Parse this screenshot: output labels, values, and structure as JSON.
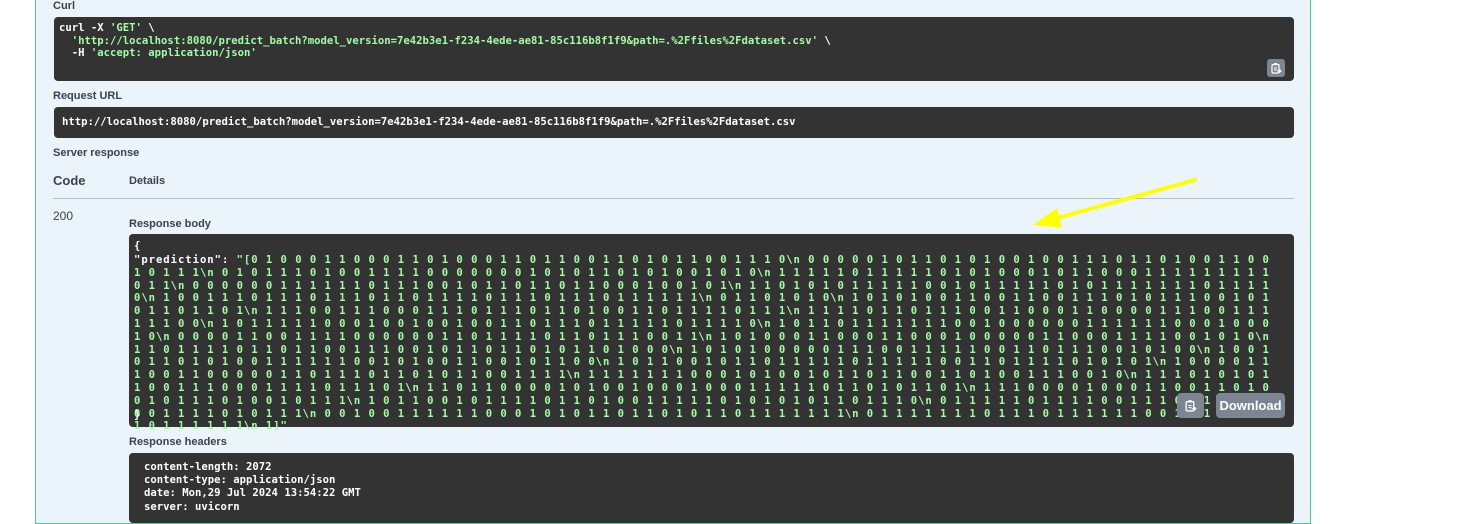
{
  "curl": {
    "label": "Curl",
    "line1_cmd": "curl -X ",
    "line1_method": "'GET'",
    "line1_end": " \\",
    "line2_url": "'http://localhost:8080/predict_batch?model_version=7e42b3e1-f234-4ede-ae81-85c116b8f1f9&path=.%2Ffiles%2Fdataset.csv'",
    "line2_end": " \\",
    "line3_flag": "-H ",
    "line3_header": "'accept: application/json'"
  },
  "request_url": {
    "label": "Request URL",
    "value": "http://localhost:8080/predict_batch?model_version=7e42b3e1-f234-4ede-ae81-85c116b8f1f9&path=.%2Ffiles%2Fdataset.csv"
  },
  "server_response": {
    "label": "Server response",
    "code_header": "Code",
    "details_header": "Details",
    "code": "200",
    "body_label": "Response body",
    "body_open": "{",
    "body_key": "\"prediction\"",
    "body_colon": ": ",
    "body_value": "\"[0 1 0 0 0 1 1 0 0 0 1 1 0 1 0 0 0 1 1 0 1 1 0 0 1 1 0 1 0 1 1 0 0 1 1 1 0\\n 0 0 0 0 0 1 0 1 1 0 1 0 1 0 0 1 0 0 1 1 1 0 1 1 0 1 0 0 1 1 0 0 1 0 1 1 1\\n 0 1 0 1 1 1 0 1 0 0 1 1 1 1 0 0 0 0 0 0 0 1 0 1 0 1 1 0 1 0 1 0 0 1 0 1 0\\n 1 1 1 1 1 0 1 1 1 1 1 0 1 0 1 0 0 0 1 0 1 1 0 0 0 1 1 1 1 1 1 1 1 1 0 1 1\\n 0 0 0 0 0 0 1 1 1 1 1 1 0 1 1 1 0 0 1 0 1 1 0 1 1 0 1 1 0 0 0 1 0 0 1 0 1\\n 1 1 0 1 0 1 0 1 1 1 1 1 0 0 1 0 1 1 1 1 1 0 1 0 1 1 1 1 1 1 1 0 1 1 1 1 0\\n 1 0 0 1 1 1 0 1 1 1 0 1 1 1 0 1 1 0 1 1 1 1 0 1 1 1 0 1 1 1 0 1 1 1 1 1 1\\n 0 1 1 0 1 0 1 0\\n 1 0 1 0 1 0 0 1 1 0 0 1 1 0 0 1 1 1 0 1 0 1 1 1 0 0 1 0 1 0 1 1 0 1 1 0 1\\n 1 1 1 0 0 1 1 1 0 0 0 1 1 1 0 1 1 1 0 1 1 0 1 0 0 1 1 0 1 1 1 1 0 1 1 1\\n 1 1 1 1 0 1 1 0 1 1 1 0 0 1 1 0 0 0 1 1 0 0 0 0 1 1 1 0 0 1 1 1 1 1 1 0 0\\n 1 0 1 1 1 1 1 0 0 0 1 0 0 1 0 0 1 0 0 1 1 0 1 1 1 0 1 1 1 1 1 0 1 1 1 1 0\\n 1 0 1 1 0 1 1 1 1 1 1 1 0 0 1 0 0 0 0 0 0 1 1 1 1 1 1 0 0 0 1 0 0 0 1 0\\n 0 0 0 0 1 1 0 0 1 1 1 1 0 0 0 0 0 0 1 1 0 1 1 1 1 0 1 1 0 1 1 1 0 0 1 1\\n 1 0 1 0 0 0 1 1 0 0 0 1 1 0 0 0 1 0 0 0 0 0 1 1 0 0 0 1 1 1 1 0 0 1 0 1 0\\n 1 1 0 1 1 1 1 0 1 1 0 1 1 0 0 1 1 1 0 0 1 0 1 1 0 1 1 0 1 0 1 1 0 1 0 0 0\\n 1 0 1 0 1 0 0 0 0 0 1 1 1 0 0 1 1 1 1 1 0 0 1 1 0 1 1 1 0 0 1 0 1 0 0\\n 1 0 0 1 0 1 1 0 1 0 1 0 0 1 1 1 1 1 1 0 0 1 0 1 0 0 1 1 0 0 1 0 1 1 0 0\\n 1 0 1 1 0 0 1 0 1 1 0 1 1 1 1 1 0 1 1 1 1 1 0 0 1 1 0 1 1 1 1 0 1 0 1 0 1\\n 1 0 0 0 0 1 1 1 0 0 1 1 0 0 0 0 0 1 1 0 1 1 1 0 1 1 0 1 0 1 1 0 0 1 1 1 1\\n 1 1 1 1 1 1 1 0 0 0 1 0 1 0 0 1 0 1 1 0 1 1 0 0 1 1 0 1 0 0 1 1 1 0 0 1 0\\n 1 1 1 0 1 0 1 0 1 1 0 0 1 1 1 0 0 0 1 1 1 1 0 1 1 1 0 1\\n 1 1 0 1 1 0 0 0 0 1 0 1 0 0 1 0 0 0 1 0 0 0 1 1 1 1 1 0 1 1 0 1 0 1 1 0 1\\n 1 1 1 0 0 0 0 1 0 0 0 1 1 0 0 1 1 0 1 0 0 1 0 1 1 1 0 1 0 0 1 0 1 1 1\\n 1 0 1 1 0 0 1 0 1 1 1 1 0 1 1 0 1 0 0 1 1 1 1 1 0 1 0 1 0 1 0 1 1 0 1 1 1 0\\n 0 1 1 1 1 1 0 1 1 1 1 0 0 1 1 1 0 0 1 0 1 0 1 0 0 1 1 1 1 0 1 0 1 1 1\\n 0 0 1 0 0 1 1 1 1 1 1 0 0 0 1 0 1 0 1 1 0 1 1 0 1 0 1 1 0 1 1 1 1 1 1 1\\n 0 1 1 1 1 1 1 1 0 1 1 1 0 1 1 1 1 1 1 0 0 1 1 1 1 0 1 1 1 0 1 1 1 1 1 1\\n 1]\"",
    "body_close": "}",
    "download_label": "Download",
    "headers_label": "Response headers",
    "headers": [
      "content-length: 2072",
      "content-type: application/json",
      "date: Mon,29 Jul 2024 13:54:22 GMT",
      "server: uvicorn"
    ]
  },
  "annotation_arrow_color": "#ffff00"
}
